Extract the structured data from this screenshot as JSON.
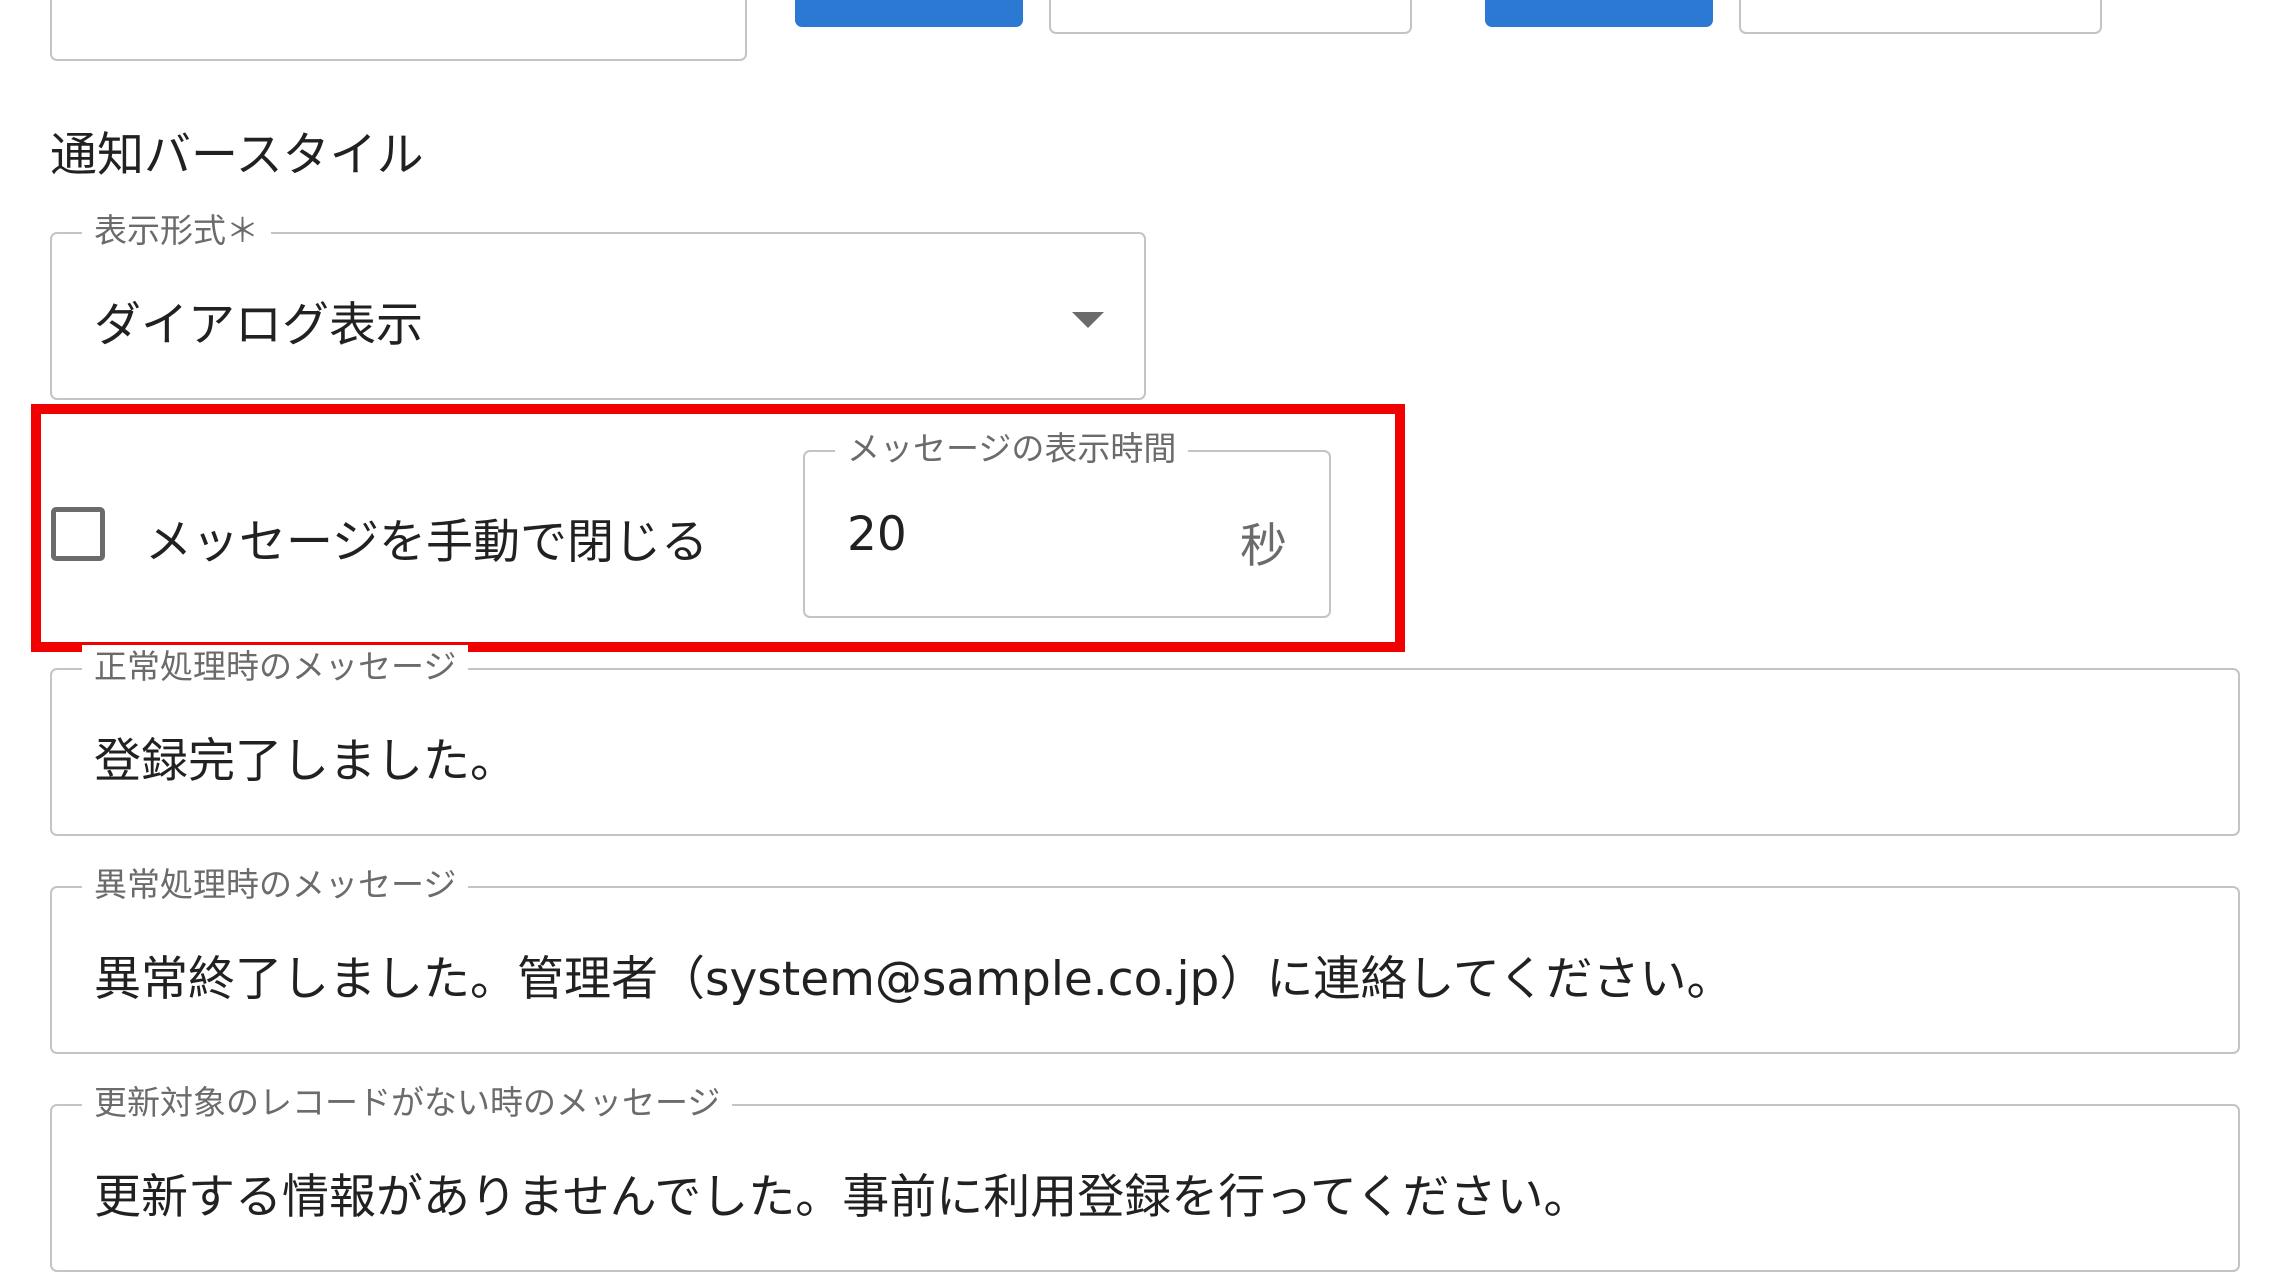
{
  "section_title": "通知バースタイル",
  "display_format": {
    "label": "表示形式＊",
    "value": "ダイアログ表示"
  },
  "manual_close": {
    "label": "メッセージを手動で閉じる",
    "checked": false
  },
  "display_time": {
    "label": "メッセージの表示時間",
    "value": "20",
    "unit": "秒"
  },
  "success_message": {
    "label": "正常処理時のメッセージ",
    "value": "登録完了しました。"
  },
  "error_message": {
    "label": "異常処理時のメッセージ",
    "value": "異常終了しました。管理者（system@sample.co.jp）に連絡してください。"
  },
  "no_record_message": {
    "label": "更新対象のレコードがない時のメッセージ",
    "value": "更新する情報がありませんでした。事前に利用登録を行ってください。"
  },
  "colors": {
    "accent_blue": "#2b79d3",
    "highlight_red": "#f00000",
    "field_border": "#c4c4c4"
  }
}
